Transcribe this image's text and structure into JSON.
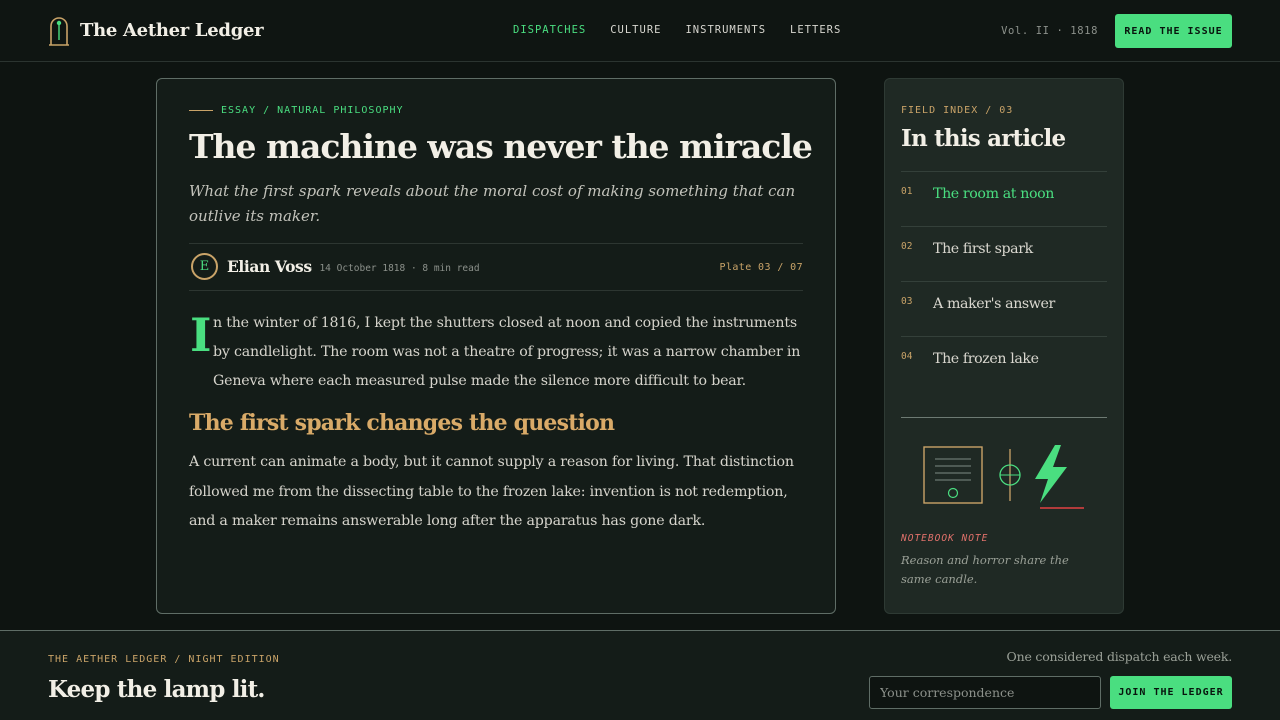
{
  "header": {
    "brand": "The Aether Ledger",
    "logo_icon": "bell-jar-icon",
    "nav": [
      {
        "label": "DISPATCHES",
        "active": true
      },
      {
        "label": "CULTURE",
        "active": false
      },
      {
        "label": "INSTRUMENTS",
        "active": false
      },
      {
        "label": "LETTERS",
        "active": false
      }
    ],
    "volume": "Vol. II · 1818",
    "cta": "READ THE ISSUE"
  },
  "article": {
    "kicker": "ESSAY / NATURAL PHILOSOPHY",
    "headline": "The machine was never the miracle",
    "dek": "What the first spark reveals about the moral cost of making something that can outlive its maker.",
    "author_initial": "E",
    "author": "Elian Voss",
    "meta": "· 14 October 1818 · 8 min read",
    "plate": "Plate 03 / 07",
    "dropcap": "I",
    "lede": "n the winter of 1816, I kept the shutters closed at noon and copied the instruments by candlelight. The room was not a theatre of progress; it was a narrow chamber in Geneva where each measured pulse made the silence more difficult to bear.",
    "subhead": "The first spark changes the question",
    "body": "A current can animate a body, but it cannot supply a reason for living. That distinction followed me from the dissecting table to the frozen lake: invention is not redemption, and a maker remains answerable long after the apparatus has gone dark."
  },
  "sidebar": {
    "field_index": "FIELD INDEX / 03",
    "title": "In this article",
    "toc": [
      {
        "num": "01",
        "label": "The room at noon",
        "active": true
      },
      {
        "num": "02",
        "label": "The first spark",
        "active": false
      },
      {
        "num": "03",
        "label": "A maker's answer",
        "active": false
      },
      {
        "num": "04",
        "label": "The frozen lake",
        "active": false
      }
    ],
    "illustration_icons": [
      "document-plate-icon",
      "crosshair-icon",
      "lightning-bolt-icon"
    ],
    "note_label": "NOTEBOOK NOTE",
    "note_text": "Reason and horror share the same candle."
  },
  "footer": {
    "kicker": "THE AETHER LEDGER / NIGHT EDITION",
    "title": "Keep the lamp lit.",
    "note": "One considered dispatch each week.",
    "input_placeholder": "Your correspondence",
    "join": "JOIN THE LEDGER"
  },
  "colors": {
    "accent": "#4ade80",
    "gold": "#c9a368",
    "alert": "#e0716b",
    "background": "#0e1411"
  }
}
